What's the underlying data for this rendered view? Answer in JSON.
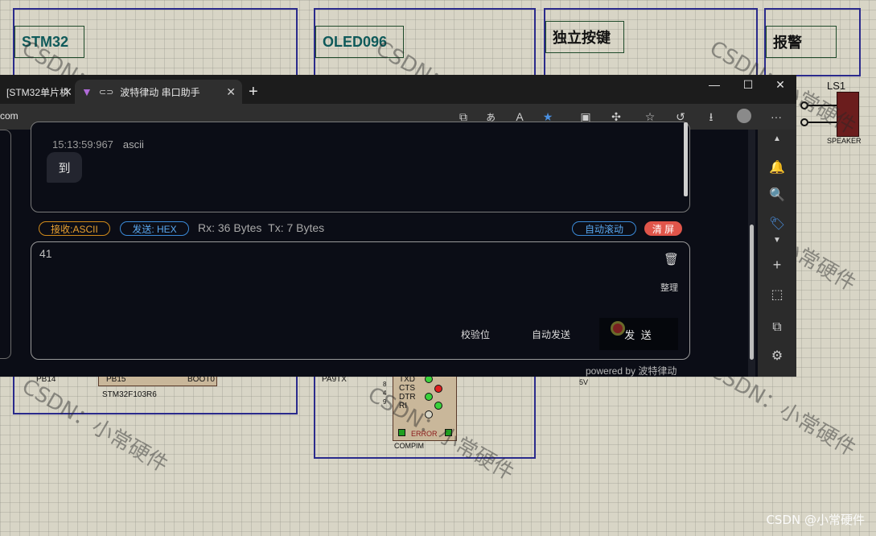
{
  "schematic": {
    "stm32_label": "STM32",
    "oled_label": "OLED096",
    "key_label": "独立按键",
    "alarm_label": "报警",
    "ls1": "LS1",
    "speaker": "SPEAKER",
    "pb14": "PB14",
    "pb15": "PB15",
    "boot0": "BOOT0",
    "chip": "STM32F103R6",
    "pa9tx": "PA9TX",
    "txd": "TXD",
    "cts": "CTS",
    "dtr": "DTR",
    "ri": "RI",
    "pin8": "8",
    "pin4": "4",
    "pin9": "9",
    "error": "ERROR",
    "compim": "COMPIM",
    "v5": "5V"
  },
  "watermarks": {
    "wm1": "CSDN：小常硬件",
    "wm2": "CSDN：小常硬件",
    "wm3": "CSDN：小常硬件",
    "wm4": "CSDN：小常硬件",
    "wm5": "CSDN：小常硬件",
    "wm6": "CSDN：小常硬件",
    "wm7": "CSDN：小常硬件",
    "corner": "CSDN @小常硬件"
  },
  "browser": {
    "tab1": "[STM32单片机",
    "tab2": "波特律动 串口助手",
    "url": "com"
  },
  "receive": {
    "timestamp": "15:13:59:967",
    "mode": "ascii",
    "message": "到"
  },
  "status": {
    "rx_mode": "接收:ASCII",
    "tx_mode": "发送: HEX",
    "rx_count": "Rx: 36 Bytes",
    "tx_count": "Tx: 7 Bytes",
    "auto_scroll": "自动滚动",
    "clear": "清 屏"
  },
  "send": {
    "value": "41",
    "tidy": "整理",
    "checksum": "校验位",
    "auto_send": "自动发送",
    "send": "发 送"
  },
  "footer": {
    "powered": "powered by 波特律动"
  }
}
